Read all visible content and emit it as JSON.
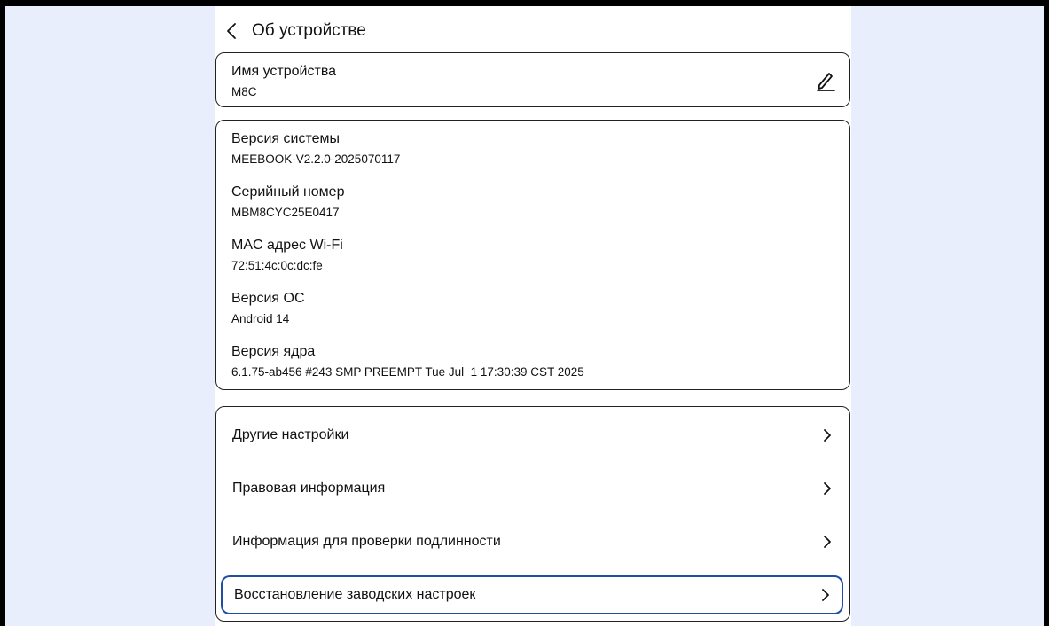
{
  "header": {
    "title": "Об устройстве"
  },
  "device_name": {
    "label": "Имя устройства",
    "value": "M8C"
  },
  "info": [
    {
      "label": "Версия системы",
      "value": "MEEBOOK-V2.2.0-2025070117"
    },
    {
      "label": "Серийный номер",
      "value": "MBM8CYC25E0417"
    },
    {
      "label": "MAC адрес Wi-Fi",
      "value": "72:51:4c:0c:dc:fe"
    },
    {
      "label": "Версия ОС",
      "value": "Android 14"
    },
    {
      "label": "Версия ядра",
      "value": "6.1.75-ab456 #243 SMP PREEMPT Tue Jul  1 17:30:39 CST 2025"
    }
  ],
  "menu": [
    {
      "label": "Другие настройки"
    },
    {
      "label": "Правовая информация"
    },
    {
      "label": "Информация для проверки подлинности"
    },
    {
      "label": "Восстановление заводских настроек"
    }
  ],
  "colors": {
    "selection_border": "#1f4fa5",
    "side_background": "#e8eefc"
  },
  "icons": {
    "back": "chevron-left-icon",
    "edit": "pencil-icon",
    "row": "chevron-right-icon"
  }
}
